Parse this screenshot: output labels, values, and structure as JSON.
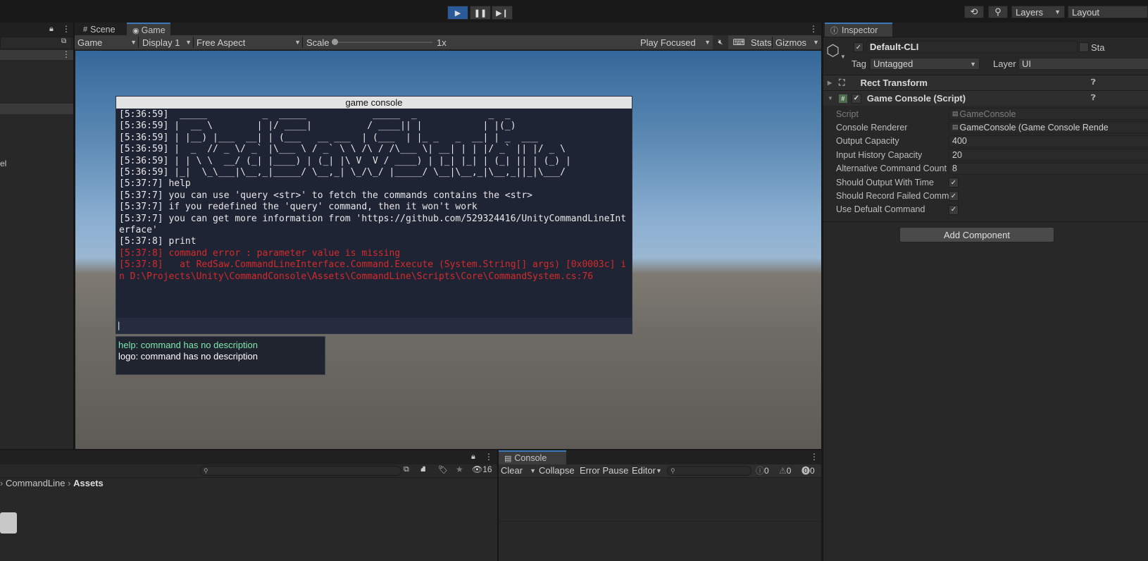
{
  "toolbar": {
    "layers_label": "Layers",
    "layout_label": "Layout",
    "icons": [
      "play-icon",
      "pause-icon",
      "step-icon",
      "history-icon",
      "search-icon"
    ]
  },
  "scene_tabs": {
    "scene": "Scene",
    "game": "Game"
  },
  "game_toolbar": {
    "mode": "Game",
    "display": "Display 1",
    "aspect": "Free Aspect",
    "scale_label": "Scale",
    "scale_value": "1x",
    "play_focused": "Play Focused",
    "stats": "Stats",
    "gizmos": "Gizmos"
  },
  "game_console": {
    "title": "game console",
    "lines": [
      {
        "text": "[5:36:59]  _____          _  _____            _____  _             _  _",
        "error": false
      },
      {
        "text": "[5:36:59] |  __ \\        | |/ ____|          / ____|| |           | |(_)",
        "error": false
      },
      {
        "text": "[5:36:59] | |__) |___  __| | (___   __ ___  | (___  | |_ _   _  __| | _  ___",
        "error": false
      },
      {
        "text": "[5:36:59] |  _  // _ \\/ _` |\\___ \\ / _` \\ \\ /\\ / /\\___ \\| __| | | |/ _` || |/ _ \\",
        "error": false
      },
      {
        "text": "[5:36:59] | | \\ \\  __/ (_| |____) | (_| |\\ V  V / ____) | |_| |_| | (_| || | (_) |",
        "error": false
      },
      {
        "text": "[5:36:59] |_|  \\_\\___|\\__,_|_____/ \\__,_| \\_/\\_/ |_____/ \\__|\\__,_|\\__,_||_|\\___/",
        "error": false
      },
      {
        "text": "[5:37:7] help",
        "error": false
      },
      {
        "text": "[5:37:7] you can use 'query <str>' to fetch the commands contains the <str>",
        "error": false
      },
      {
        "text": "[5:37:7] if you redefined the 'query' command, then it won't work",
        "error": false
      },
      {
        "text": "[5:37:7] you can get more information from 'https://github.com/529324416/UnityCommandLineInterface'",
        "error": false
      },
      {
        "text": "[5:37:8] print",
        "error": false
      },
      {
        "text": "[5:37:8] command error : parameter value is missing",
        "error": true
      },
      {
        "text": "[5:37:8]   at RedSaw.CommandLineInterface.Command.Execute (System.String[] args) [0x0003c] in D:\\Projects\\Unity\\CommandConsole\\Assets\\CommandLine\\Scripts\\Core\\CommandSystem.cs:76",
        "error": true
      }
    ],
    "input_value": "|",
    "suggestions": [
      {
        "text": "help: command has no description",
        "color": "#7fe8b0"
      },
      {
        "text": "logo: command has no description",
        "color": "#ffffff"
      }
    ]
  },
  "inspector": {
    "tab": "Inspector",
    "object_name": "Default-CLI",
    "static_label": "Sta",
    "tag_label": "Tag",
    "tag_value": "Untagged",
    "layer_label": "Layer",
    "layer_value": "UI",
    "components": {
      "rect": "Rect Transform",
      "console": "Game Console (Script)"
    },
    "fields": [
      {
        "label": "Script",
        "value": "GameConsole",
        "kind": "ref"
      },
      {
        "label": "Console Renderer",
        "value": "GameConsole (Game Console Rende",
        "kind": "ref"
      },
      {
        "label": "Output Capacity",
        "value": "400",
        "kind": "num"
      },
      {
        "label": "Input History Capacity",
        "value": "20",
        "kind": "num"
      },
      {
        "label": "Alternative Command Count",
        "value": "8",
        "kind": "num"
      },
      {
        "label": "Should Output With Time",
        "value": "✓",
        "kind": "check"
      },
      {
        "label": "Should Record Failed Comm",
        "value": "✓",
        "kind": "check"
      },
      {
        "label": "Use Defualt Command",
        "value": "✓",
        "kind": "check"
      }
    ],
    "add_component": "Add Component"
  },
  "project": {
    "breadcrumb_1": "CommandLine",
    "breadcrumb_2": "Assets",
    "hidden_count": "16"
  },
  "console_panel": {
    "tab": "Console",
    "clear": "Clear",
    "collapse": "Collapse",
    "error_pause": "Error Pause",
    "editor": "Editor",
    "log_count": "0",
    "warn_count": "0",
    "err_count": "0"
  },
  "colors": {
    "accent": "#3a79bb",
    "error_text": "#d62a2a",
    "suggest_highlight": "#7fe8b0"
  }
}
